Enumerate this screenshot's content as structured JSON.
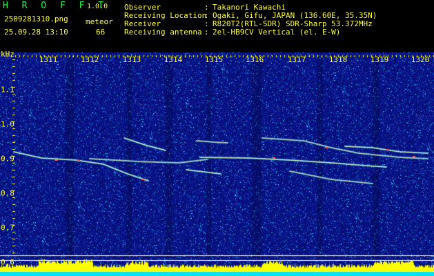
{
  "app": {
    "title": "H R O F F T",
    "version": "1.0.0",
    "filename": "2509281310.png",
    "datetime": "25.09.28 13:10",
    "meteor_label": "meteor",
    "meteor_count": "66"
  },
  "info": [
    {
      "label": "Observer",
      "sep": ":",
      "value": "Takanori Kawachi"
    },
    {
      "label": "Receiving Location",
      "sep": ":",
      "value": "Ogaki, Gifu, JAPAN (136.60E, 35.35N)"
    },
    {
      "label": "Receiver",
      "sep": ":",
      "value": "R820T2(RTL-SDR) SDR-Sharp 53.372MHz"
    },
    {
      "label": "Receiving antenna",
      "sep": ":",
      "value": "2el-HB9CV Vertical (el. E-W)"
    }
  ],
  "axis": {
    "y_unit": "kHz",
    "x_ticks": [
      "1311",
      "1312",
      "1313",
      "1314",
      "1315",
      "1316",
      "1317",
      "1318",
      "1319",
      "1320"
    ],
    "y_ticks": [
      "1.1",
      "1.0",
      "0.9",
      "0.8",
      "0.7",
      "0.6"
    ]
  },
  "colors": {
    "background": "#0a1a8c",
    "labels": "#ffff33",
    "header_green": "#22ff44",
    "echo": "#ff5050",
    "level_bar": "#ffff00",
    "baseline": "#00e0ff"
  }
}
